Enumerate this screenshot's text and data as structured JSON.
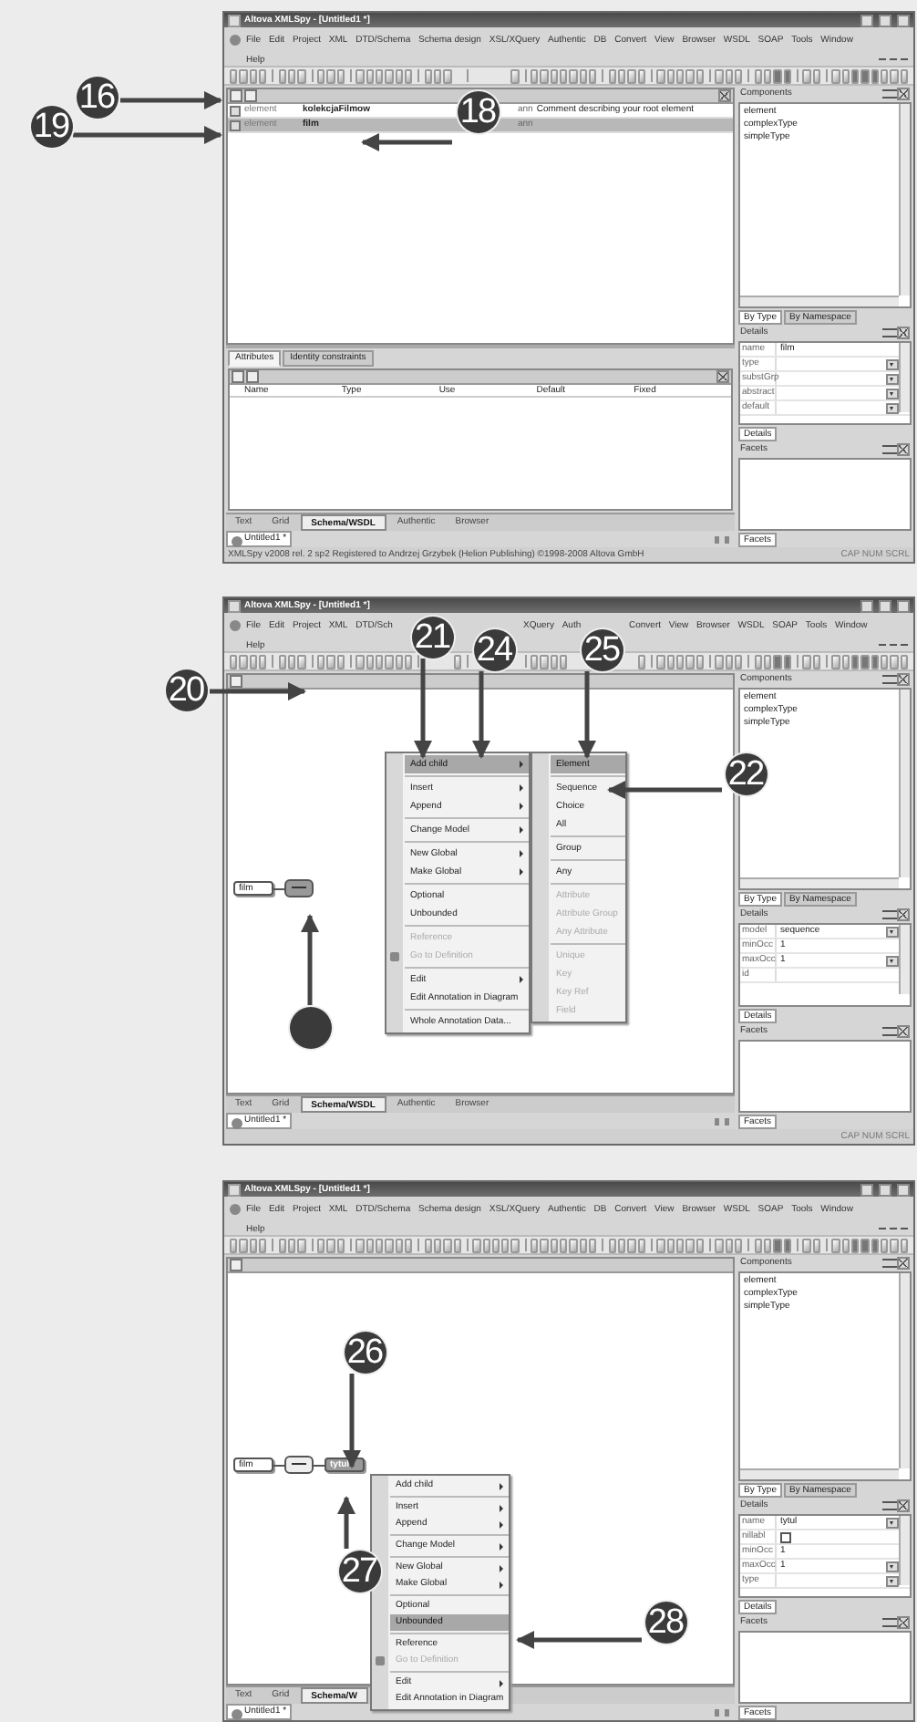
{
  "screens": [
    {
      "title": "Altova XMLSpy - [Untitled1 *]",
      "menu": [
        "File",
        "Edit",
        "Project",
        "XML",
        "DTD/Schema",
        "Schema design",
        "XSL/XQuery",
        "Authentic",
        "DB",
        "Convert",
        "View",
        "Browser",
        "WSDL",
        "SOAP",
        "Tools",
        "Window",
        "Help"
      ],
      "editor": {
        "kind": "grid",
        "rows": [
          {
            "type_label": "element",
            "name": "kolekcjaFilmow",
            "annotation": "ann",
            "comment": "Comment describing your root element",
            "selected": false
          },
          {
            "type_label": "element",
            "name": "film",
            "annotation": "ann",
            "selected": true
          }
        ]
      },
      "bottom_pane": {
        "tabs": [
          {
            "label": "Attributes",
            "selected": true
          },
          {
            "label": "Identity constraints",
            "selected": false
          }
        ],
        "columns": [
          "Name",
          "Type",
          "Use",
          "Default",
          "Fixed"
        ]
      },
      "view_tabs": [
        {
          "label": "Text",
          "selected": false
        },
        {
          "label": "Grid",
          "selected": false
        },
        {
          "label": "Schema/WSDL",
          "selected": true
        },
        {
          "label": "Authentic",
          "selected": false
        },
        {
          "label": "Browser",
          "selected": false
        }
      ],
      "document_tab": "Untitled1 *",
      "status_bar": {
        "text": "XMLSpy v2008 rel. 2 sp2   Registered to Andrzej Grzybek (Helion Publishing)   ©1998-2008 Altova GmbH",
        "indicators": "CAP NUM SCRL"
      },
      "components": {
        "title": "Components",
        "items": [
          "element",
          "complexType",
          "simpleType"
        ],
        "tabs": [
          {
            "label": "By Type",
            "selected": true
          },
          {
            "label": "By Namespace",
            "selected": false
          }
        ]
      },
      "details": {
        "title": "Details",
        "tab": "Details",
        "rows": [
          {
            "label": "name",
            "kind": "text",
            "value": "film"
          },
          {
            "label": "type",
            "kind": "dropdown"
          },
          {
            "label": "substGrp",
            "kind": "dropdown"
          },
          {
            "label": "abstract",
            "kind": "dropdown"
          },
          {
            "label": "default",
            "kind": "dropdown"
          }
        ]
      },
      "facets": {
        "title": "Facets",
        "tab": "Facets"
      },
      "callouts": [
        {
          "label": "16"
        },
        {
          "label": "19"
        },
        {
          "label": "18"
        }
      ]
    },
    {
      "title": "Altova XMLSpy - [Untitled1 *]",
      "menu": [
        "File",
        "Edit",
        "Project",
        "XML",
        "DTD/Sch",
        "XQuery",
        "Auth",
        "Convert",
        "View",
        "Browser",
        "WSDL",
        "SOAP",
        "Tools",
        "Window",
        "Help"
      ],
      "editor": {
        "kind": "diagram",
        "nodes": [
          {
            "kind": "element",
            "label": "film",
            "selected": false
          },
          {
            "kind": "sequence",
            "selected": true
          }
        ],
        "context_menu": {
          "groups": [
            [
              {
                "label": "Add child",
                "submenu": true,
                "selected": true,
                "disabled": false
              }
            ],
            [
              {
                "label": "Insert",
                "submenu": true,
                "selected": false,
                "disabled": false
              },
              {
                "label": "Append",
                "submenu": true,
                "selected": false,
                "disabled": false
              }
            ],
            [
              {
                "label": "Change Model",
                "submenu": true,
                "selected": false,
                "disabled": false
              }
            ],
            [
              {
                "label": "New Global",
                "submenu": true,
                "selected": false,
                "disabled": false
              },
              {
                "label": "Make Global",
                "submenu": true,
                "selected": false,
                "disabled": false
              }
            ],
            [
              {
                "label": "Optional",
                "submenu": false,
                "selected": false,
                "disabled": false
              },
              {
                "label": "Unbounded",
                "submenu": false,
                "selected": false,
                "disabled": false
              }
            ],
            [
              {
                "label": "Reference",
                "submenu": false,
                "selected": false,
                "disabled": true
              },
              {
                "label": "Go to Definition",
                "submenu": false,
                "selected": false,
                "disabled": true,
                "has_icon": true
              }
            ],
            [
              {
                "label": "Edit",
                "submenu": true,
                "selected": false,
                "disabled": false
              },
              {
                "label": "Edit Annotation in Diagram",
                "submenu": false,
                "selected": false,
                "disabled": false
              }
            ],
            [
              {
                "label": "Whole Annotation Data...",
                "submenu": false,
                "selected": false,
                "disabled": false
              }
            ]
          ]
        },
        "submenu": {
          "groups": [
            [
              {
                "label": "Element",
                "selected": true,
                "disabled": false
              }
            ],
            [
              {
                "label": "Sequence",
                "selected": false,
                "disabled": false
              },
              {
                "label": "Choice",
                "selected": false,
                "disabled": false
              },
              {
                "label": "All",
                "selected": false,
                "disabled": false
              }
            ],
            [
              {
                "label": "Group",
                "selected": false,
                "disabled": false
              }
            ],
            [
              {
                "label": "Any",
                "selected": false,
                "disabled": false
              }
            ],
            [
              {
                "label": "Attribute",
                "selected": false,
                "disabled": true
              },
              {
                "label": "Attribute Group",
                "selected": false,
                "disabled": true
              },
              {
                "label": "Any Attribute",
                "selected": false,
                "disabled": true
              }
            ],
            [
              {
                "label": "Unique",
                "selected": false,
                "disabled": true
              },
              {
                "label": "Key",
                "selected": false,
                "disabled": true
              },
              {
                "label": "Key Ref",
                "selected": false,
                "disabled": true
              },
              {
                "label": "Field",
                "selected": false,
                "disabled": true
              }
            ]
          ]
        }
      },
      "view_tabs": [
        {
          "label": "Text",
          "selected": false
        },
        {
          "label": "Grid",
          "selected": false
        },
        {
          "label": "Schema/WSDL",
          "selected": true
        },
        {
          "label": "Authentic",
          "selected": false
        },
        {
          "label": "Browser",
          "selected": false
        }
      ],
      "document_tab": "Untitled1 *",
      "status_bar": {
        "indicators": "CAP NUM SCRL"
      },
      "components": {
        "title": "Components",
        "items": [
          "element",
          "complexType",
          "simpleType"
        ],
        "tabs": [
          {
            "label": "By Type",
            "selected": true
          },
          {
            "label": "By Namespace",
            "selected": false
          }
        ]
      },
      "details": {
        "title": "Details",
        "tab": "Details",
        "rows": [
          {
            "label": "model",
            "kind": "dropdown",
            "value": "sequence"
          },
          {
            "label": "minOcc",
            "kind": "text",
            "value": "1"
          },
          {
            "label": "maxOcc",
            "kind": "dropdown",
            "value": "1"
          },
          {
            "label": "id",
            "kind": "text"
          }
        ]
      },
      "facets": {
        "title": "Facets",
        "tab": "Facets"
      },
      "callouts": [
        {
          "label": "21"
        },
        {
          "label": "24"
        },
        {
          "label": "25"
        },
        {
          "label": "20"
        },
        {
          "label": "22"
        }
      ]
    },
    {
      "title": "Altova XMLSpy - [Untitled1 *]",
      "menu": [
        "File",
        "Edit",
        "Project",
        "XML",
        "DTD/Schema",
        "Schema design",
        "XSL/XQuery",
        "Authentic",
        "DB",
        "Convert",
        "View",
        "Browser",
        "WSDL",
        "SOAP",
        "Tools",
        "Window",
        "Help"
      ],
      "editor": {
        "kind": "diagram",
        "nodes": [
          {
            "kind": "element",
            "label": "film",
            "selected": false
          },
          {
            "kind": "sequence",
            "selected": false
          },
          {
            "kind": "element",
            "label": "tytul",
            "selected": true
          }
        ],
        "context_menu": {
          "groups": [
            [
              {
                "label": "Add child",
                "submenu": true,
                "selected": false,
                "disabled": false
              }
            ],
            [
              {
                "label": "Insert",
                "submenu": true,
                "selected": false,
                "disabled": false
              },
              {
                "label": "Append",
                "submenu": true,
                "selected": false,
                "disabled": false
              }
            ],
            [
              {
                "label": "Change Model",
                "submenu": true,
                "selected": false,
                "disabled": false
              }
            ],
            [
              {
                "label": "New Global",
                "submenu": true,
                "selected": false,
                "disabled": false
              },
              {
                "label": "Make Global",
                "submenu": true,
                "selected": false,
                "disabled": false
              }
            ],
            [
              {
                "label": "Optional",
                "submenu": false,
                "selected": false,
                "disabled": false
              },
              {
                "label": "Unbounded",
                "submenu": false,
                "selected": true,
                "disabled": false
              }
            ],
            [
              {
                "label": "Reference",
                "submenu": false,
                "selected": false,
                "disabled": false
              },
              {
                "label": "Go to Definition",
                "submenu": false,
                "selected": false,
                "disabled": true,
                "has_icon": true
              }
            ],
            [
              {
                "label": "Edit",
                "submenu": true,
                "selected": false,
                "disabled": false
              },
              {
                "label": "Edit Annotation in Diagram",
                "submenu": false,
                "selected": false,
                "disabled": false
              }
            ]
          ]
        }
      },
      "view_tabs": [
        {
          "label": "Text",
          "selected": false
        },
        {
          "label": "Grid",
          "selected": false
        },
        {
          "label": "Schema/W",
          "selected": true
        }
      ],
      "document_tab": "Untitled1 *",
      "components": {
        "title": "Components",
        "items": [
          "element",
          "complexType",
          "simpleType"
        ],
        "tabs": [
          {
            "label": "By Type",
            "selected": true
          },
          {
            "label": "By Namespace",
            "selected": false
          }
        ]
      },
      "details": {
        "title": "Details",
        "tab": "Details",
        "rows": [
          {
            "label": "name",
            "kind": "dropdown",
            "value": "tytul"
          },
          {
            "label": "nillabl",
            "kind": "checkbox",
            "checked": false
          },
          {
            "label": "minOcc",
            "kind": "text",
            "value": "1"
          },
          {
            "label": "maxOcc",
            "kind": "dropdown",
            "value": "1"
          },
          {
            "label": "type",
            "kind": "dropdown"
          }
        ]
      },
      "facets": {
        "title": "Facets",
        "tab": "Facets"
      },
      "callouts": [
        {
          "label": "26"
        },
        {
          "label": "27"
        },
        {
          "label": "28"
        }
      ]
    }
  ]
}
